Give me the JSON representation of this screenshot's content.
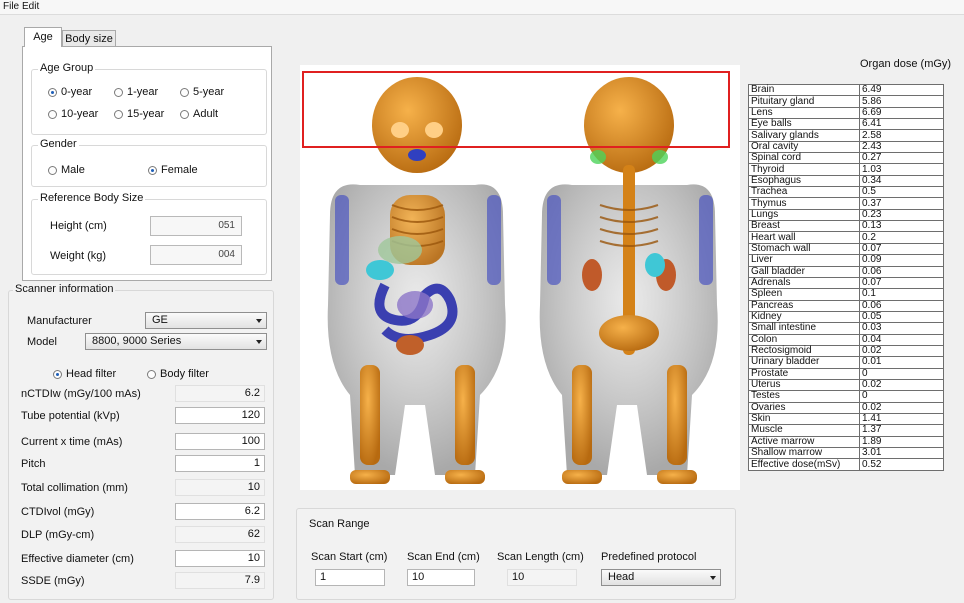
{
  "menu": {
    "file": "File",
    "edit": "Edit"
  },
  "tabs": [
    {
      "label": "Age"
    },
    {
      "label": "Body size"
    }
  ],
  "age_group": {
    "title": "Age Group",
    "options": [
      "0-year",
      "1-year",
      "5-year",
      "10-year",
      "15-year",
      "Adult"
    ],
    "selected": "0-year"
  },
  "gender": {
    "title": "Gender",
    "options": [
      "Male",
      "Female"
    ],
    "selected": "Female"
  },
  "reference_body": {
    "title": "Reference Body Size",
    "height_label": "Height (cm)",
    "height_value": "051",
    "weight_label": "Weight (kg)",
    "weight_value": "004"
  },
  "scanner": {
    "title": "Scanner information",
    "manufacturer_label": "Manufacturer",
    "manufacturer_value": "GE",
    "model_label": "Model",
    "model_value": "8800, 9000 Series",
    "filter_head": "Head filter",
    "filter_body": "Body filter",
    "filter_selected": "Head filter",
    "fields": [
      {
        "label": "nCTDIw (mGy/100 mAs)",
        "value": "6.2",
        "readonly": true
      },
      {
        "label": "Tube potential (kVp)",
        "value": "120",
        "readonly": false
      },
      {
        "label": "Current x time (mAs)",
        "value": "100",
        "readonly": false
      },
      {
        "label": "Pitch",
        "value": "1",
        "readonly": false
      },
      {
        "label": "Total collimation (mm)",
        "value": "10",
        "readonly": true
      },
      {
        "label": "CTDIvol (mGy)",
        "value": "6.2",
        "readonly": false
      },
      {
        "label": "DLP (mGy-cm)",
        "value": "62",
        "readonly": true
      },
      {
        "label": "Effective diameter (cm)",
        "value": "10",
        "readonly": false
      },
      {
        "label": "SSDE (mGy)",
        "value": "7.9",
        "readonly": true
      }
    ]
  },
  "scan_range": {
    "title": "Scan Range",
    "start_label": "Scan Start (cm)",
    "start_value": "1",
    "end_label": "Scan End (cm)",
    "end_value": "10",
    "length_label": "Scan Length (cm)",
    "length_value": "10",
    "protocol_label": "Predefined protocol",
    "protocol_value": "Head"
  },
  "organ_dose": {
    "title": "Organ dose (mGy)",
    "rows": [
      [
        "Brain",
        "6.49"
      ],
      [
        "Pituitary gland",
        "5.86"
      ],
      [
        "Lens",
        "6.69"
      ],
      [
        "Eye balls",
        "6.41"
      ],
      [
        "Salivary glands",
        "2.58"
      ],
      [
        "Oral cavity",
        "2.43"
      ],
      [
        "Spinal cord",
        "0.27"
      ],
      [
        "Thyroid",
        "1.03"
      ],
      [
        "Esophagus",
        "0.34"
      ],
      [
        "Trachea",
        "0.5"
      ],
      [
        "Thymus",
        "0.37"
      ],
      [
        "Lungs",
        "0.23"
      ],
      [
        "Breast",
        "0.13"
      ],
      [
        "Heart wall",
        "0.2"
      ],
      [
        "Stomach wall",
        "0.07"
      ],
      [
        "Liver",
        "0.09"
      ],
      [
        "Gall bladder",
        "0.06"
      ],
      [
        "Adrenals",
        "0.07"
      ],
      [
        "Spleen",
        "0.1"
      ],
      [
        "Pancreas",
        "0.06"
      ],
      [
        "Kidney",
        "0.05"
      ],
      [
        "Small intestine",
        "0.03"
      ],
      [
        "Colon",
        "0.04"
      ],
      [
        "Rectosigmoid",
        "0.02"
      ],
      [
        "Urinary bladder",
        "0.01"
      ],
      [
        "Prostate",
        "0"
      ],
      [
        "Uterus",
        "0.02"
      ],
      [
        "Testes",
        "0"
      ],
      [
        "Ovaries",
        "0.02"
      ],
      [
        "Skin",
        "1.41"
      ],
      [
        "Muscle",
        "1.37"
      ],
      [
        "Active marrow",
        "1.89"
      ],
      [
        "Shallow marrow",
        "3.01"
      ],
      [
        "Effective dose(mSv)",
        "0.52"
      ]
    ]
  },
  "colors": {
    "highlight_box": "#e02020",
    "skeleton": "#e08a1e",
    "body_shell": "#a8a8a8"
  }
}
